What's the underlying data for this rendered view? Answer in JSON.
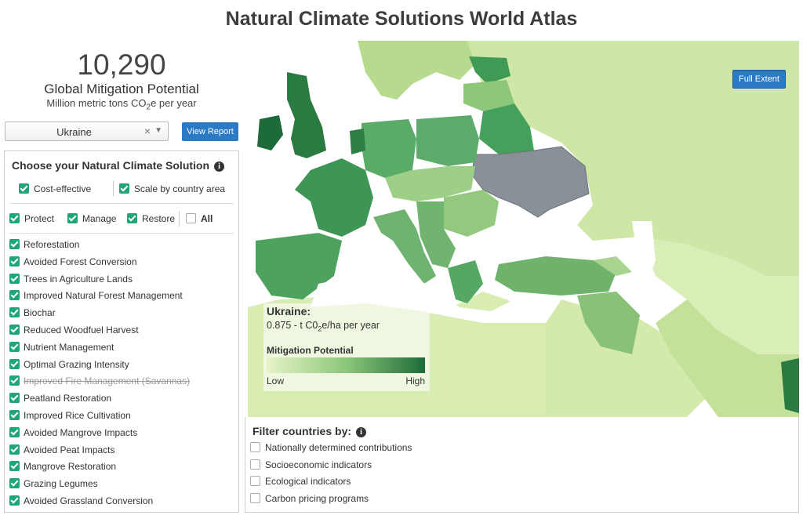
{
  "title": "Natural Climate Solutions World Atlas",
  "stat": {
    "value": "10,290",
    "label": "Global Mitigation Potential",
    "units_prefix": "Million metric tons CO",
    "units_sub": "2",
    "units_suffix": "e per year"
  },
  "country_select": {
    "value": "Ukraine",
    "clear_glyph": "×",
    "caret_glyph": "▼"
  },
  "view_report_label": "View Report",
  "panel": {
    "title": "Choose your Natural Climate Solution",
    "info_glyph": "i",
    "toggles": [
      {
        "label": "Cost-effective",
        "checked": true
      },
      {
        "label": "Scale by country area",
        "checked": true
      }
    ],
    "categories": [
      {
        "label": "Protect",
        "checked": true
      },
      {
        "label": "Manage",
        "checked": true
      },
      {
        "label": "Restore",
        "checked": true
      },
      {
        "label": "All",
        "checked": false
      }
    ],
    "solutions": [
      {
        "label": "Reforestation",
        "checked": true,
        "disabled": false
      },
      {
        "label": "Avoided Forest Conversion",
        "checked": true,
        "disabled": false
      },
      {
        "label": "Trees in Agriculture Lands",
        "checked": true,
        "disabled": false
      },
      {
        "label": "Improved Natural Forest Management",
        "checked": true,
        "disabled": false
      },
      {
        "label": "Biochar",
        "checked": true,
        "disabled": false
      },
      {
        "label": "Reduced Woodfuel Harvest",
        "checked": true,
        "disabled": false
      },
      {
        "label": "Nutrient Management",
        "checked": true,
        "disabled": false
      },
      {
        "label": "Optimal Grazing Intensity",
        "checked": true,
        "disabled": false
      },
      {
        "label": "Improved Fire Management (Savannas)",
        "checked": true,
        "disabled": true
      },
      {
        "label": "Peatland Restoration",
        "checked": true,
        "disabled": false
      },
      {
        "label": "Improved Rice Cultivation",
        "checked": true,
        "disabled": false
      },
      {
        "label": "Avoided Mangrove Impacts",
        "checked": true,
        "disabled": false
      },
      {
        "label": "Avoided Peat Impacts",
        "checked": true,
        "disabled": false
      },
      {
        "label": "Mangrove Restoration",
        "checked": true,
        "disabled": false
      },
      {
        "label": "Grazing Legumes",
        "checked": true,
        "disabled": false
      },
      {
        "label": "Avoided Grassland Conversion",
        "checked": true,
        "disabled": false
      }
    ]
  },
  "map": {
    "full_extent_label": "Full Extent",
    "selected_color": "#8a9097",
    "legend": {
      "country": "Ukraine:",
      "value_prefix": "0.875 - t C0",
      "value_sub": "2",
      "value_suffix": "e/ha per year",
      "title": "Mitigation Potential",
      "low": "Low",
      "high": "High",
      "gradient": [
        "#e6f3c8",
        "#8cc77a",
        "#1e6b3a"
      ]
    }
  },
  "filter": {
    "title": "Filter countries by:",
    "info_glyph": "i",
    "items": [
      {
        "label": "Nationally determined contributions",
        "checked": false
      },
      {
        "label": "Socioeconomic indicators",
        "checked": false
      },
      {
        "label": "Ecological indicators",
        "checked": false
      },
      {
        "label": "Carbon pricing programs",
        "checked": false
      }
    ]
  }
}
